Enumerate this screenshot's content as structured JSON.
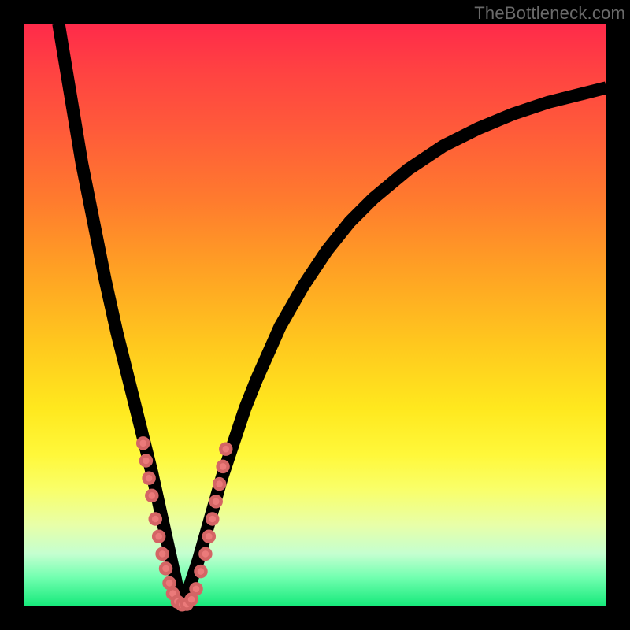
{
  "watermark": "TheBottleneck.com",
  "colors": {
    "page_bg": "#000000",
    "curve_stroke": "#000000",
    "marker_fill": "#eb7a7a",
    "marker_stroke": "#d46565",
    "gradient_top": "#ff2a4a",
    "gradient_mid": "#ffe81e",
    "gradient_bottom": "#15e97a"
  },
  "chart_data": {
    "type": "line",
    "title": "",
    "xlabel": "",
    "ylabel": "",
    "xlim": [
      0,
      100
    ],
    "ylim": [
      0,
      100
    ],
    "grid": false,
    "legend": false,
    "notes": "V-shaped bottleneck curve; y≈0 (green) means balanced, y→100 (red) means severe bottleneck. Minimum near x≈27. Axes unlabeled.",
    "series": [
      {
        "name": "bottleneck-curve",
        "x": [
          6,
          8,
          10,
          12,
          14,
          16,
          18,
          20,
          22,
          24,
          26,
          27,
          28,
          30,
          32,
          34,
          36,
          38,
          40,
          44,
          48,
          52,
          56,
          60,
          66,
          72,
          78,
          84,
          90,
          96,
          100
        ],
        "y": [
          100,
          88,
          76,
          66,
          56,
          47,
          39,
          31,
          23,
          14,
          5,
          0,
          2,
          8,
          15,
          22,
          28,
          34,
          39,
          48,
          55,
          61,
          66,
          70,
          75,
          79,
          82,
          84.5,
          86.5,
          88,
          89
        ]
      }
    ],
    "markers": [
      {
        "x": 20.5,
        "y": 28
      },
      {
        "x": 21,
        "y": 25
      },
      {
        "x": 21.5,
        "y": 22
      },
      {
        "x": 22,
        "y": 19
      },
      {
        "x": 22.6,
        "y": 15
      },
      {
        "x": 23.2,
        "y": 12
      },
      {
        "x": 23.8,
        "y": 9
      },
      {
        "x": 24.4,
        "y": 6.5
      },
      {
        "x": 25,
        "y": 4
      },
      {
        "x": 25.6,
        "y": 2.2
      },
      {
        "x": 26.4,
        "y": 0.8
      },
      {
        "x": 27.2,
        "y": 0.3
      },
      {
        "x": 28,
        "y": 0.4
      },
      {
        "x": 28.8,
        "y": 1.2
      },
      {
        "x": 29.6,
        "y": 3
      },
      {
        "x": 30.4,
        "y": 6
      },
      {
        "x": 31.2,
        "y": 9
      },
      {
        "x": 31.8,
        "y": 12
      },
      {
        "x": 32.4,
        "y": 15
      },
      {
        "x": 33,
        "y": 18
      },
      {
        "x": 33.6,
        "y": 21
      },
      {
        "x": 34.2,
        "y": 24
      },
      {
        "x": 34.7,
        "y": 27
      }
    ]
  }
}
